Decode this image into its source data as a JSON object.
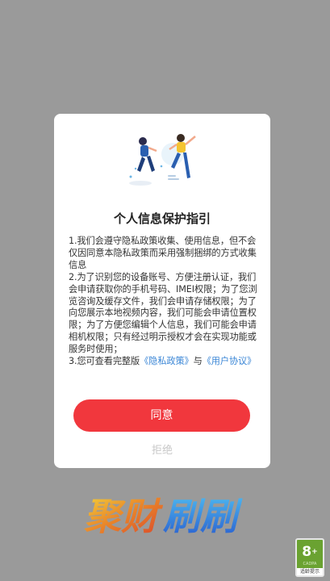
{
  "dialog": {
    "title": "个人信息保护指引",
    "para1": "1.我们会遵守隐私政策收集、使用信息，但不会仅因同意本隐私政策而采用强制捆绑的方式收集信息",
    "para2": "2.为了识别您的设备账号、方便注册认证，我们会申请获取你的手机号码、IMEI权限；为了您浏览咨询及缓存文件，我们会申请存储权限；为了向您展示本地视频内容，我们可能会申请位置权限；为了方便您编辑个人信息，我们可能会申请相机权限；只有经过明示授权才会在实现功能或服务时使用；",
    "para3_prefix": "3.您可查看完整版",
    "privacy_link": "《隐私政策》",
    "para3_mid": "与",
    "user_link": "《用户协议》",
    "agree_label": "同意",
    "reject_label": "拒绝"
  },
  "brand": {
    "text": "聚财刷刷"
  },
  "age_badge": {
    "number": "8",
    "plus": "+",
    "sub": "CADPA",
    "label": "适龄提示",
    "color": "#6aa231"
  },
  "colors": {
    "accent": "#f1373d",
    "link": "#3a86d6",
    "backdrop": "#9a9a9a"
  }
}
